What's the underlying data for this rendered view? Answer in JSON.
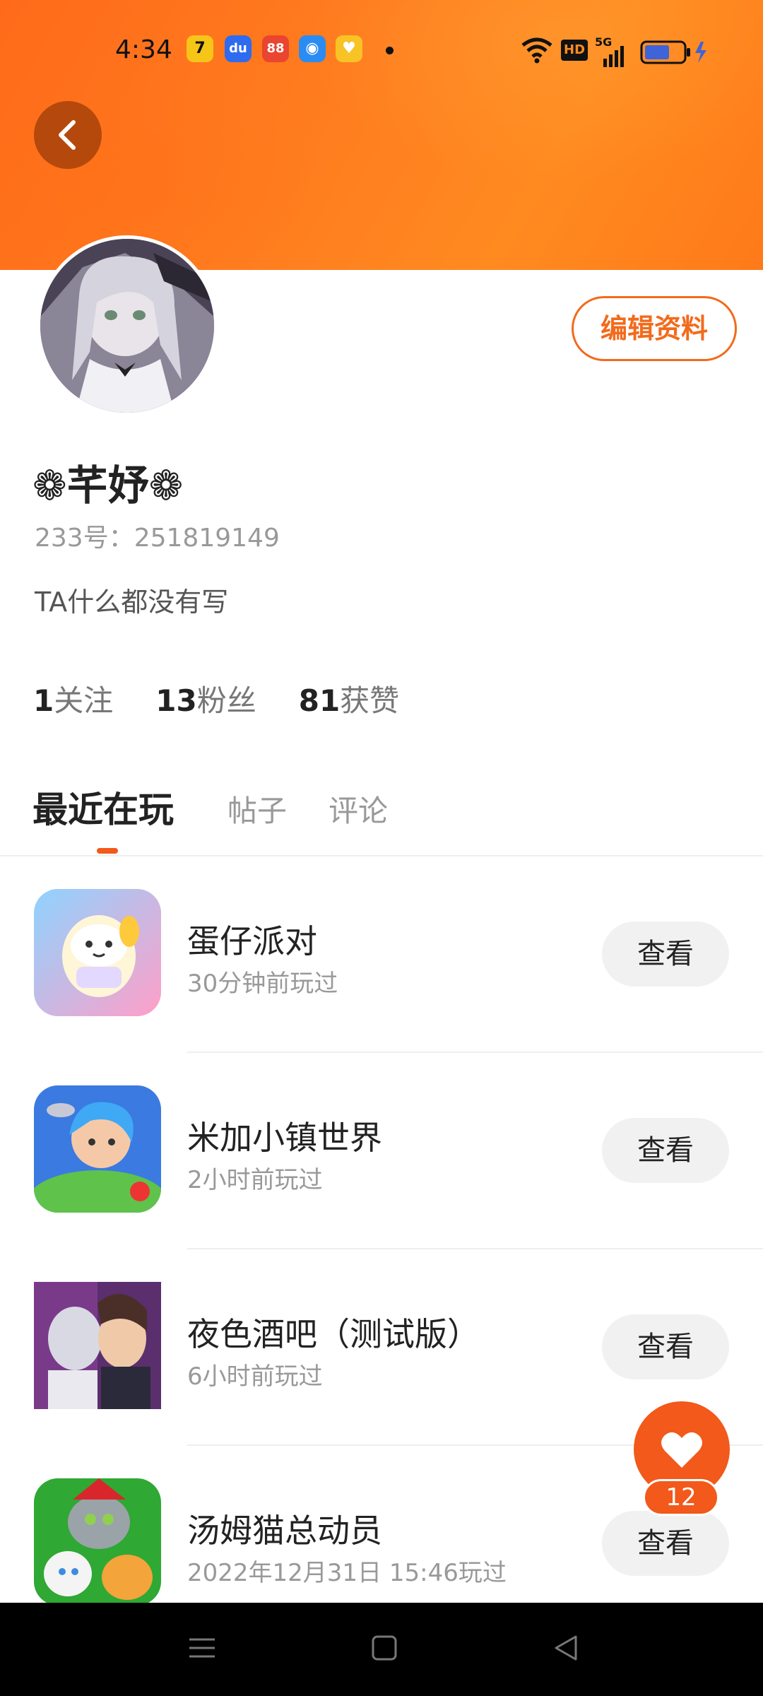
{
  "status_bar": {
    "time": "4:34",
    "apps": [
      {
        "icon": "app-7-icon",
        "glyph": "7",
        "color": "#f5c518"
      },
      {
        "icon": "baidu-icon",
        "glyph": "du",
        "color": "#2e6bf0"
      },
      {
        "icon": "app-red-icon",
        "glyph": "88",
        "color": "#e9452f"
      },
      {
        "icon": "app-blue-icon",
        "glyph": "◉",
        "color": "#2a8cf2"
      },
      {
        "icon": "app-yellow-icon",
        "glyph": "♥",
        "color": "#f7c325"
      }
    ],
    "network_badge": "HD",
    "network_type": "5G"
  },
  "profile": {
    "edit_label": "编辑资料",
    "username": "❁芊妤❁",
    "id_text": "233号：251819149",
    "bio": "TA什么都没有写"
  },
  "stats": [
    {
      "num": "1",
      "label": "关注"
    },
    {
      "num": "13",
      "label": "粉丝"
    },
    {
      "num": "81",
      "label": "获赞"
    }
  ],
  "tabs": [
    {
      "label": "最近在玩",
      "active": true
    },
    {
      "label": "帖子",
      "active": false
    },
    {
      "label": "评论",
      "active": false
    }
  ],
  "games": [
    {
      "name": "蛋仔派对",
      "time": "30分钟前玩过",
      "button": "查看"
    },
    {
      "name": "米加小镇世界",
      "time": "2小时前玩过",
      "button": "查看"
    },
    {
      "name": "夜色酒吧（测试版）",
      "time": "6小时前玩过",
      "button": "查看"
    },
    {
      "name": "汤姆猫总动员",
      "time": "2022年12月31日 15:46玩过",
      "button": "查看"
    }
  ],
  "like": {
    "count": "12"
  },
  "colors": {
    "accent": "#f2591a",
    "header": "#ff7a1a"
  }
}
